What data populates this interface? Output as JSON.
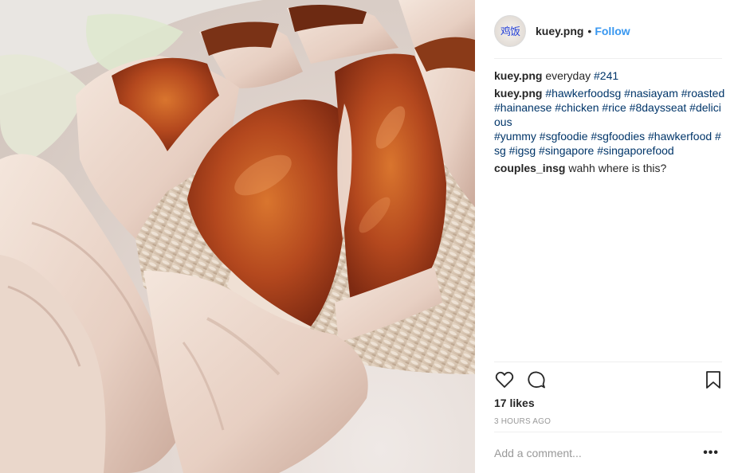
{
  "post": {
    "image_alt": "food-photo-roasted-chicken-rice",
    "avatar_text": "鸡饭",
    "username": "kuey.png",
    "separator": "•",
    "follow_label": "Follow",
    "caption": {
      "user": "kuey.png",
      "text": "everyday",
      "tag": "#241"
    },
    "hashtag_comment": {
      "user": "kuey.png",
      "tags_line1": "#hawkerfoodsg #nasiayam #roasted #hainanese #chicken #rice #8daysseat #delicious",
      "tags_line2": "#yummy #sgfoodie #sgfoodies #hawkerfood #sg #igsg #singapore #singaporefood"
    },
    "comments": [
      {
        "user": "couples_insg",
        "text": "wahh where is this?"
      }
    ],
    "likes": "17 likes",
    "time": "3 HOURS AGO",
    "add_comment_placeholder": "Add a comment...",
    "more_label": "•••",
    "icons": {
      "like": "heart-icon",
      "comment": "comment-bubble-icon",
      "save": "bookmark-icon"
    }
  }
}
